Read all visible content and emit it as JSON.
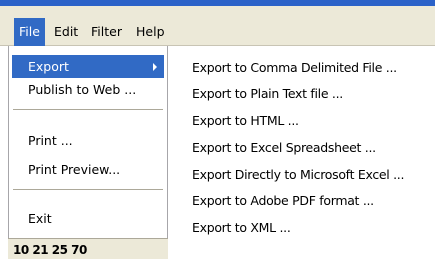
{
  "menubar": {
    "items": [
      {
        "label": "File",
        "active": true
      },
      {
        "label": "Edit",
        "active": false
      },
      {
        "label": "Filter",
        "active": false
      },
      {
        "label": "Help",
        "active": false
      }
    ]
  },
  "file_menu": {
    "items": [
      {
        "label": "Export",
        "highlighted": true,
        "has_submenu": true
      },
      {
        "label": "Publish to Web ..."
      },
      {
        "label": "Print ..."
      },
      {
        "label": "Print Preview..."
      },
      {
        "label": "Exit"
      }
    ]
  },
  "export_submenu": {
    "items": [
      {
        "label": "Export to Comma Delimited File ..."
      },
      {
        "label": "Export to Plain Text file ..."
      },
      {
        "label": "Export to HTML ..."
      },
      {
        "label": "Export to Excel Spreadsheet ..."
      },
      {
        "label": "Export Directly to Microsoft Excel ..."
      },
      {
        "label": "Export to Adobe PDF format ..."
      },
      {
        "label": "Export to XML ..."
      }
    ]
  },
  "background_field": {
    "text": "10 21 25 70"
  },
  "colors": {
    "highlight": "#316ac5",
    "menubar_bg": "#ece9d8",
    "titlebar": "#2b62c8"
  }
}
